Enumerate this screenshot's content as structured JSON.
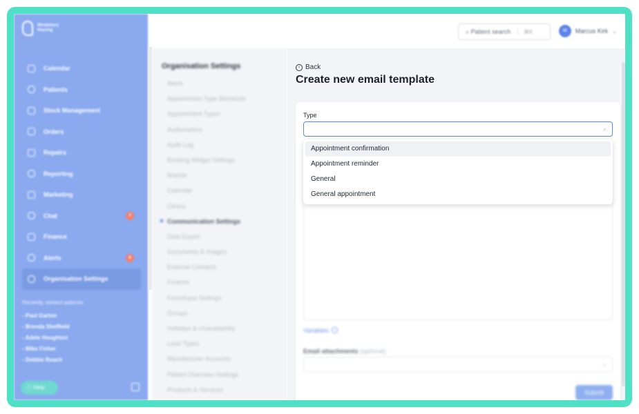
{
  "brand": {
    "name": "Windsbury Hearing"
  },
  "sidebar": {
    "items": [
      {
        "label": "Calendar",
        "icon": "calendar-icon"
      },
      {
        "label": "Patients",
        "icon": "user-icon"
      },
      {
        "label": "Stock Management",
        "icon": "box-icon"
      },
      {
        "label": "Orders",
        "icon": "cart-icon"
      },
      {
        "label": "Repairs",
        "icon": "wrench-icon"
      },
      {
        "label": "Reporting",
        "icon": "chart-icon"
      },
      {
        "label": "Marketing",
        "icon": "mail-icon"
      },
      {
        "label": "Chat",
        "icon": "chat-icon",
        "badge": "7"
      },
      {
        "label": "Finance",
        "icon": "card-icon"
      },
      {
        "label": "Alerts",
        "icon": "bell-icon",
        "badge": "8"
      },
      {
        "label": "Organisation Settings",
        "icon": "gear-icon"
      }
    ],
    "recent_title": "Recently viewed patients",
    "recent": [
      "- Paul Garton",
      "- Brenda Sheffield",
      "- Adele Houghton",
      "- Mike Fisher",
      "- Debbie Roach"
    ],
    "help_label": "Help"
  },
  "topbar": {
    "search_label": "Patient search",
    "search_shortcut": "⌘K",
    "user_initial": "M",
    "user_name": "Marcus Kirk"
  },
  "submenu": {
    "title": "Organisation Settings",
    "items": [
      "Alerts",
      "Appointment Type Blockouts",
      "Appointment Types",
      "Audiometers",
      "Audit Log",
      "Booking Widget Settings",
      "Brands",
      "Calendar",
      "Clinics",
      "Communication Settings",
      "Data Export",
      "Documents & Images",
      "External Contacts",
      "Finance",
      "Form/Input Settings",
      "Groups",
      "Holidays & Unavailability",
      "Lead Types",
      "Manufacturer Accounts",
      "Patient Overview Settings",
      "Products & Services"
    ],
    "current": "Communication Settings"
  },
  "content": {
    "back_label": "Back",
    "title": "Create new email template",
    "type_label": "Type",
    "type_value": "",
    "type_options": [
      "Appointment confirmation",
      "Appointment reminder",
      "General",
      "General appointment"
    ],
    "variables_label": "Variables",
    "attachments_label": "Email attachments",
    "attachments_optional": "(optional)",
    "submit_label": "Submit"
  },
  "colors": {
    "sidebar": "#8aa9ee",
    "accent": "#5b86e6",
    "frame": "#4fe0c6",
    "badge": "#f27f6a"
  }
}
